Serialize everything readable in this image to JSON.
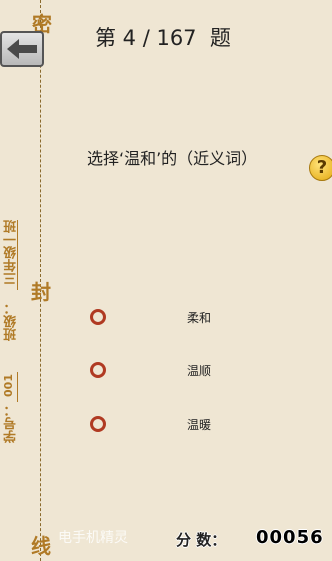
{
  "header": {
    "title": "第 4 / 167  题"
  },
  "question": {
    "text": "选择‘温和’的（近义词）"
  },
  "options": [
    {
      "label": "柔和"
    },
    {
      "label": "温顺"
    },
    {
      "label": "温暖"
    }
  ],
  "margin": {
    "seal_chars": [
      "密",
      "封",
      "线"
    ],
    "class_label": "班级：",
    "class_value": "三年级一班",
    "id_label": "学号：",
    "id_value": "001"
  },
  "footer": {
    "watermark": "电手机精灵",
    "score_label": "分 数：",
    "score_value": "00056"
  },
  "icons": {
    "back": "back-arrow-icon",
    "help": "question-mark-icon"
  },
  "colors": {
    "background": "#efe6d3",
    "accent": "#b07a26",
    "radio": "#b03a22"
  }
}
